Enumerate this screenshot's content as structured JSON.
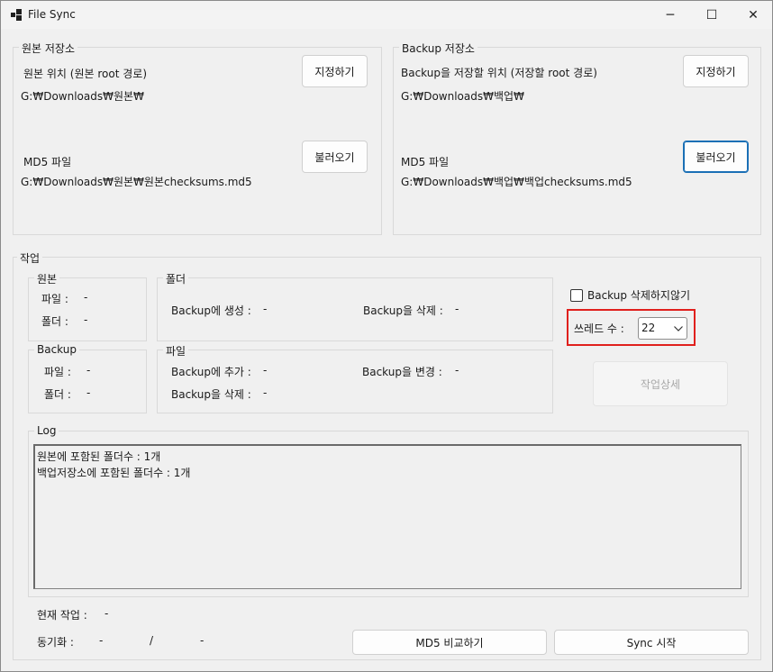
{
  "window": {
    "title": "File Sync",
    "minimize": "─",
    "maximize": "☐",
    "close": "✕"
  },
  "source": {
    "group_label": "원본 저장소",
    "location_label": "원본 위치 (원본 root 경로)",
    "location_path": "G:₩Downloads₩원본₩",
    "set_button": "지정하기",
    "md5_label": "MD5 파일",
    "md5_path": "G:₩Downloads₩원본₩원본checksums.md5",
    "load_button": "불러오기"
  },
  "backup": {
    "group_label": "Backup 저장소",
    "location_label": "Backup을 저장할 위치 (저장할 root 경로)",
    "location_path": "G:₩Downloads₩백업₩",
    "set_button": "지정하기",
    "md5_label": "MD5 파일",
    "md5_path": "G:₩Downloads₩백업₩백업checksums.md5",
    "load_button": "불러오기"
  },
  "job": {
    "group_label": "작업",
    "source_box": {
      "label": "원본",
      "files_label": "파일 :",
      "files_value": "-",
      "folders_label": "폴더 :",
      "folders_value": "-"
    },
    "backup_box": {
      "label": "Backup",
      "files_label": "파일 :",
      "files_value": "-",
      "folders_label": "폴더 :",
      "folders_value": "-"
    },
    "folder_box": {
      "label": "폴더",
      "create_label": "Backup에 생성 :",
      "create_value": "-",
      "delete_label": "Backup을 삭제 :",
      "delete_value": "-"
    },
    "file_box": {
      "label": "파일",
      "add_label": "Backup에 추가 :",
      "add_value": "-",
      "change_label": "Backup을 변경 :",
      "change_value": "-",
      "delete_label": "Backup을 삭제 :",
      "delete_value": "-"
    },
    "no_delete_checkbox": "Backup 삭제하지않기",
    "no_delete_checked": false,
    "threads_label": "쓰레드 수 :",
    "threads_value": "22",
    "detail_button": "작업상세"
  },
  "log": {
    "label": "Log",
    "lines": [
      "원본에 포함된 폴더수 : 1개",
      "백업저장소에 포함된 폴더수 : 1개"
    ]
  },
  "status": {
    "current_label": "현재 작업 :",
    "current_value": "-",
    "sync_label": "동기화 :",
    "sync_done": "-",
    "sync_sep": "/",
    "sync_total": "-"
  },
  "actions": {
    "md5_compare": "MD5 비교하기",
    "sync_start": "Sync 시작"
  },
  "colors": {
    "highlight": "#e0201d",
    "focus": "#1a6fb5"
  }
}
